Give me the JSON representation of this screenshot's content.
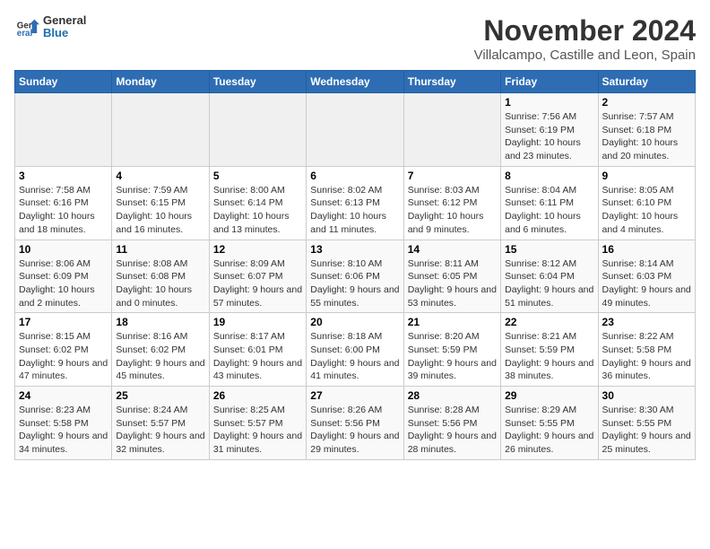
{
  "header": {
    "logo": {
      "general": "General",
      "blue": "Blue"
    },
    "title": "November 2024",
    "subtitle": "Villalcampo, Castille and Leon, Spain"
  },
  "days_of_week": [
    "Sunday",
    "Monday",
    "Tuesday",
    "Wednesday",
    "Thursday",
    "Friday",
    "Saturday"
  ],
  "weeks": [
    [
      {
        "day": "",
        "info": ""
      },
      {
        "day": "",
        "info": ""
      },
      {
        "day": "",
        "info": ""
      },
      {
        "day": "",
        "info": ""
      },
      {
        "day": "",
        "info": ""
      },
      {
        "day": "1",
        "info": "Sunrise: 7:56 AM\nSunset: 6:19 PM\nDaylight: 10 hours and 23 minutes."
      },
      {
        "day": "2",
        "info": "Sunrise: 7:57 AM\nSunset: 6:18 PM\nDaylight: 10 hours and 20 minutes."
      }
    ],
    [
      {
        "day": "3",
        "info": "Sunrise: 7:58 AM\nSunset: 6:16 PM\nDaylight: 10 hours and 18 minutes."
      },
      {
        "day": "4",
        "info": "Sunrise: 7:59 AM\nSunset: 6:15 PM\nDaylight: 10 hours and 16 minutes."
      },
      {
        "day": "5",
        "info": "Sunrise: 8:00 AM\nSunset: 6:14 PM\nDaylight: 10 hours and 13 minutes."
      },
      {
        "day": "6",
        "info": "Sunrise: 8:02 AM\nSunset: 6:13 PM\nDaylight: 10 hours and 11 minutes."
      },
      {
        "day": "7",
        "info": "Sunrise: 8:03 AM\nSunset: 6:12 PM\nDaylight: 10 hours and 9 minutes."
      },
      {
        "day": "8",
        "info": "Sunrise: 8:04 AM\nSunset: 6:11 PM\nDaylight: 10 hours and 6 minutes."
      },
      {
        "day": "9",
        "info": "Sunrise: 8:05 AM\nSunset: 6:10 PM\nDaylight: 10 hours and 4 minutes."
      }
    ],
    [
      {
        "day": "10",
        "info": "Sunrise: 8:06 AM\nSunset: 6:09 PM\nDaylight: 10 hours and 2 minutes."
      },
      {
        "day": "11",
        "info": "Sunrise: 8:08 AM\nSunset: 6:08 PM\nDaylight: 10 hours and 0 minutes."
      },
      {
        "day": "12",
        "info": "Sunrise: 8:09 AM\nSunset: 6:07 PM\nDaylight: 9 hours and 57 minutes."
      },
      {
        "day": "13",
        "info": "Sunrise: 8:10 AM\nSunset: 6:06 PM\nDaylight: 9 hours and 55 minutes."
      },
      {
        "day": "14",
        "info": "Sunrise: 8:11 AM\nSunset: 6:05 PM\nDaylight: 9 hours and 53 minutes."
      },
      {
        "day": "15",
        "info": "Sunrise: 8:12 AM\nSunset: 6:04 PM\nDaylight: 9 hours and 51 minutes."
      },
      {
        "day": "16",
        "info": "Sunrise: 8:14 AM\nSunset: 6:03 PM\nDaylight: 9 hours and 49 minutes."
      }
    ],
    [
      {
        "day": "17",
        "info": "Sunrise: 8:15 AM\nSunset: 6:02 PM\nDaylight: 9 hours and 47 minutes."
      },
      {
        "day": "18",
        "info": "Sunrise: 8:16 AM\nSunset: 6:02 PM\nDaylight: 9 hours and 45 minutes."
      },
      {
        "day": "19",
        "info": "Sunrise: 8:17 AM\nSunset: 6:01 PM\nDaylight: 9 hours and 43 minutes."
      },
      {
        "day": "20",
        "info": "Sunrise: 8:18 AM\nSunset: 6:00 PM\nDaylight: 9 hours and 41 minutes."
      },
      {
        "day": "21",
        "info": "Sunrise: 8:20 AM\nSunset: 5:59 PM\nDaylight: 9 hours and 39 minutes."
      },
      {
        "day": "22",
        "info": "Sunrise: 8:21 AM\nSunset: 5:59 PM\nDaylight: 9 hours and 38 minutes."
      },
      {
        "day": "23",
        "info": "Sunrise: 8:22 AM\nSunset: 5:58 PM\nDaylight: 9 hours and 36 minutes."
      }
    ],
    [
      {
        "day": "24",
        "info": "Sunrise: 8:23 AM\nSunset: 5:58 PM\nDaylight: 9 hours and 34 minutes."
      },
      {
        "day": "25",
        "info": "Sunrise: 8:24 AM\nSunset: 5:57 PM\nDaylight: 9 hours and 32 minutes."
      },
      {
        "day": "26",
        "info": "Sunrise: 8:25 AM\nSunset: 5:57 PM\nDaylight: 9 hours and 31 minutes."
      },
      {
        "day": "27",
        "info": "Sunrise: 8:26 AM\nSunset: 5:56 PM\nDaylight: 9 hours and 29 minutes."
      },
      {
        "day": "28",
        "info": "Sunrise: 8:28 AM\nSunset: 5:56 PM\nDaylight: 9 hours and 28 minutes."
      },
      {
        "day": "29",
        "info": "Sunrise: 8:29 AM\nSunset: 5:55 PM\nDaylight: 9 hours and 26 minutes."
      },
      {
        "day": "30",
        "info": "Sunrise: 8:30 AM\nSunset: 5:55 PM\nDaylight: 9 hours and 25 minutes."
      }
    ]
  ]
}
